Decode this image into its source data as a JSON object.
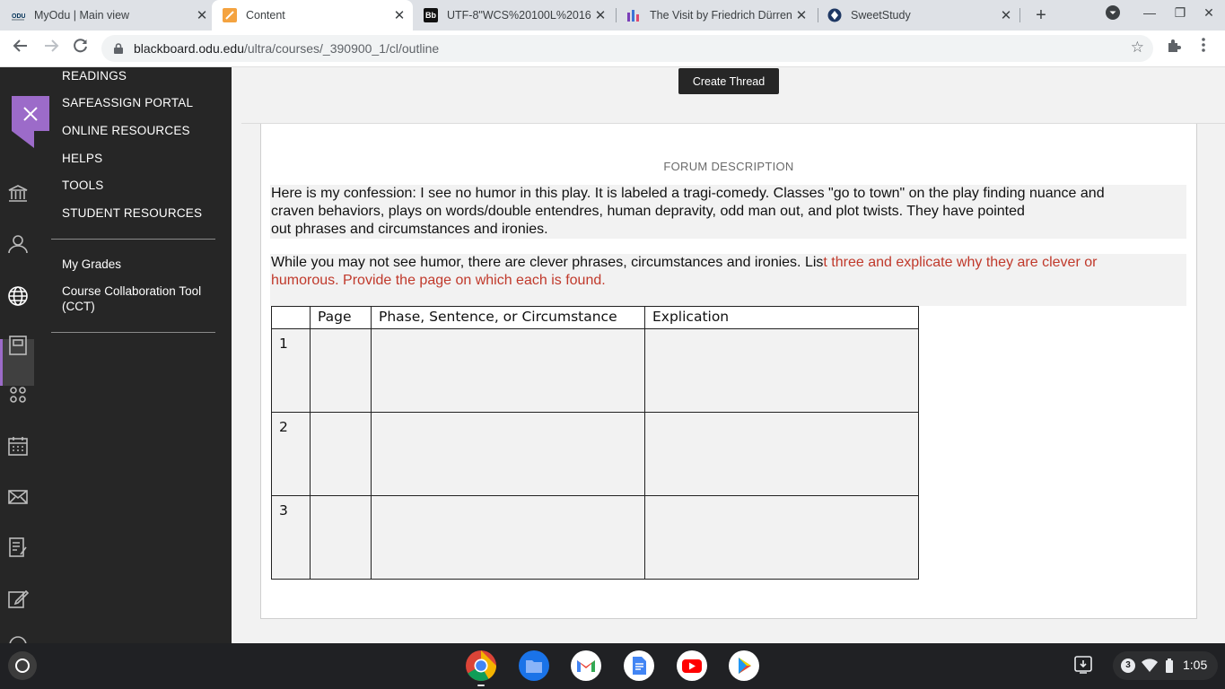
{
  "browser": {
    "tabs": [
      {
        "title": "MyOdu | Main view",
        "icon": "odu-logo-icon"
      },
      {
        "title": "Content",
        "icon": "blackboard-content-icon"
      },
      {
        "title": "UTF-8\"WCS%20100L%2016",
        "icon": "bb-icon"
      },
      {
        "title": "The Visit by Friedrich Dürren",
        "icon": "chart-bars-icon"
      },
      {
        "title": "SweetStudy",
        "icon": "sweetstudy-icon"
      }
    ],
    "url_host": "blackboard.odu.edu",
    "url_path": "/ultra/courses/_390900_1/cl/outline"
  },
  "course_menu": {
    "items": [
      "READINGS",
      "SAFEASSIGN PORTAL",
      "ONLINE RESOURCES",
      "HELPS",
      "TOOLS",
      "STUDENT RESOURCES"
    ],
    "links": [
      "My Grades",
      "Course Collaboration Tool",
      "(CCT)"
    ]
  },
  "main": {
    "create_thread_label": "Create Thread",
    "forum_description_label": "FORUM DESCRIPTION",
    "paragraph1": {
      "line1": "Here is my confession:  I see no humor in this play.  It is labeled a tragi-comedy.  Classes \"go to town\" on the play finding nuance and",
      "line2": "craven behaviors, plays on words/double entendres, human depravity, odd man out, and plot twists.  They have pointed",
      "line3": "out phrases and circumstances and ironies."
    },
    "paragraph2": {
      "black": "While you may not see humor, there are clever phrases, circumstances and ironies.  Lis",
      "red_line1": "t three and explicate why they are clever or",
      "red_line2": "humorous.  Provide the page on which each is found."
    },
    "table": {
      "headers": [
        "",
        "Page",
        "Phase, Sentence, or Circumstance",
        "Explication"
      ],
      "rows": [
        "1",
        "2",
        "3"
      ]
    }
  },
  "shelf": {
    "notification_count": "3",
    "time": "1:05"
  },
  "colors": {
    "dark_panel": "#262626",
    "accent_purple": "#9c6bc9",
    "instruction_red": "#c0392b"
  }
}
